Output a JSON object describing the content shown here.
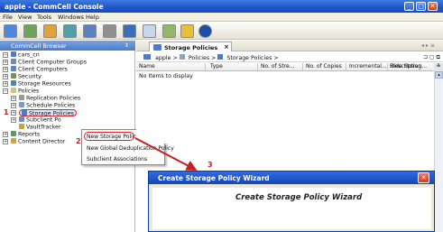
{
  "window": {
    "title": "apple - CommCell Console"
  },
  "menu": {
    "items": [
      "File",
      "View",
      "Tools",
      "Windows",
      "Help"
    ]
  },
  "left_pane": {
    "header": "CommCell Browser",
    "pin": "↕"
  },
  "tree": {
    "root": "cars_cn",
    "items": [
      "Client Computer Groups",
      "Client Computers",
      "Security",
      "Storage Resources",
      "Policies",
      "Replication Policies",
      "Schedule Policies",
      "Storage Policies",
      "Subclient Po",
      "VaultTracker",
      "Reports",
      "Content Director"
    ]
  },
  "context_menu": {
    "items": [
      "New Storage Policy",
      "New Global Deduplication Policy",
      "Subclient Associations"
    ]
  },
  "steps": {
    "one": "1",
    "two": "2",
    "three": "3"
  },
  "tab": {
    "label": "Storage Policies",
    "close": "×"
  },
  "breadcrumb": {
    "parts": [
      "apple",
      "Policies",
      "Storage Policies"
    ]
  },
  "table": {
    "columns": [
      "Name",
      "Type",
      "No. of Stre...",
      "No. of Copies",
      "Incremental...",
      "Description",
      "Hide Storag..."
    ],
    "empty_message": "No Items to display"
  },
  "wizard": {
    "title": "Create Storage Policy Wizard",
    "heading": "Create Storage Policy Wizard",
    "close": "✕"
  },
  "colors": {
    "title_bar": "#1f55c5",
    "accent_red": "#d9252b"
  }
}
